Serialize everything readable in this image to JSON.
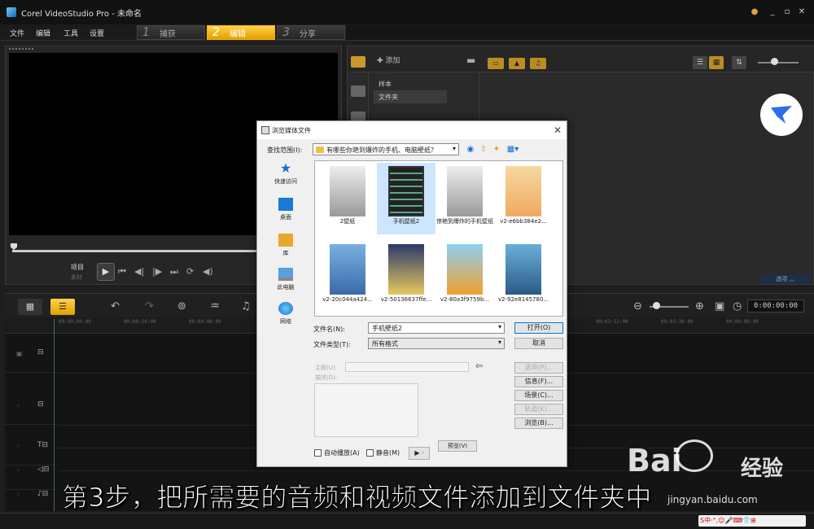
{
  "app": {
    "title": "Corel VideoStudio Pro - 未命名",
    "menu": [
      "文件",
      "编辑",
      "工具",
      "设置"
    ],
    "steps": [
      {
        "num": "1",
        "label": "捕获"
      },
      {
        "num": "2",
        "label": "编辑"
      },
      {
        "num": "3",
        "label": "分享"
      }
    ],
    "active_step": "编辑"
  },
  "preview": {
    "project_label": "项目",
    "clip_label": "素材"
  },
  "library": {
    "add_label": "添加",
    "folders": [
      "样本",
      "文件夹"
    ],
    "selected_folder": "文件夹",
    "corner_label": "选项 ︿"
  },
  "timeline": {
    "timecode": "0:00:00:00",
    "ruler_ticks": [
      "00:00:00:00",
      "00:00:24:00",
      "00:00:48:00",
      "00:03:12:00",
      "00:03:36:00",
      "00:04:00:00"
    ]
  },
  "dialog": {
    "title": "浏览媒体文件",
    "look_in_label": "查找范围(I):",
    "look_in_value": "有哪些你艳到爆炸的手机、电脑壁纸？",
    "places": [
      "快速访问",
      "桌面",
      "库",
      "此电脑",
      "网络"
    ],
    "files": [
      {
        "name": "2壁纸",
        "kind": "video"
      },
      {
        "name": "手机壁纸2",
        "kind": "film"
      },
      {
        "name": "惊艳到爆炸的手机壁纸",
        "kind": "video"
      },
      {
        "name": "v2-e6bb384e2...",
        "kind": "img1"
      },
      {
        "name": "v2-20c044a424...",
        "kind": "img2"
      },
      {
        "name": "v2-50136637ffe...",
        "kind": "img3"
      },
      {
        "name": "v2-80a3f9759b...",
        "kind": "img4"
      },
      {
        "name": "v2-92e8145780...",
        "kind": "img5"
      }
    ],
    "selected_file": "手机壁纸2",
    "filename_label": "文件名(N):",
    "filename_value": "手机壁纸2",
    "filetype_label": "文件类型(T):",
    "filetype_value": "所有格式",
    "open_button": "打开(O)",
    "cancel_button": "取消",
    "subject_label": "主题(U):",
    "description_label": "描述(D):",
    "options_button": "选项(P)...",
    "info_button": "信息(F)...",
    "scenes_button": "场景(C)...",
    "tracks_button": "轨道(K)...",
    "browse_button": "浏览(B)...",
    "autoplay_label": "自动播放(A)",
    "mute_label": "静音(M)",
    "play_label": "▶ ·",
    "preview_button": "预览(V)"
  },
  "overlay": {
    "subtitle": "第3步，把所需要的音频和视频文件添加到文件夹中",
    "watermark": "Bai",
    "watermark_cn": "经验",
    "watermark_url": "jingyan.baidu.com",
    "ime_text": "S中·°,☺🎤⌨👕⊞"
  },
  "colors": {
    "accent": "#e8a800",
    "background": "#1e1e1e",
    "dialog": "#f0f0f0"
  }
}
